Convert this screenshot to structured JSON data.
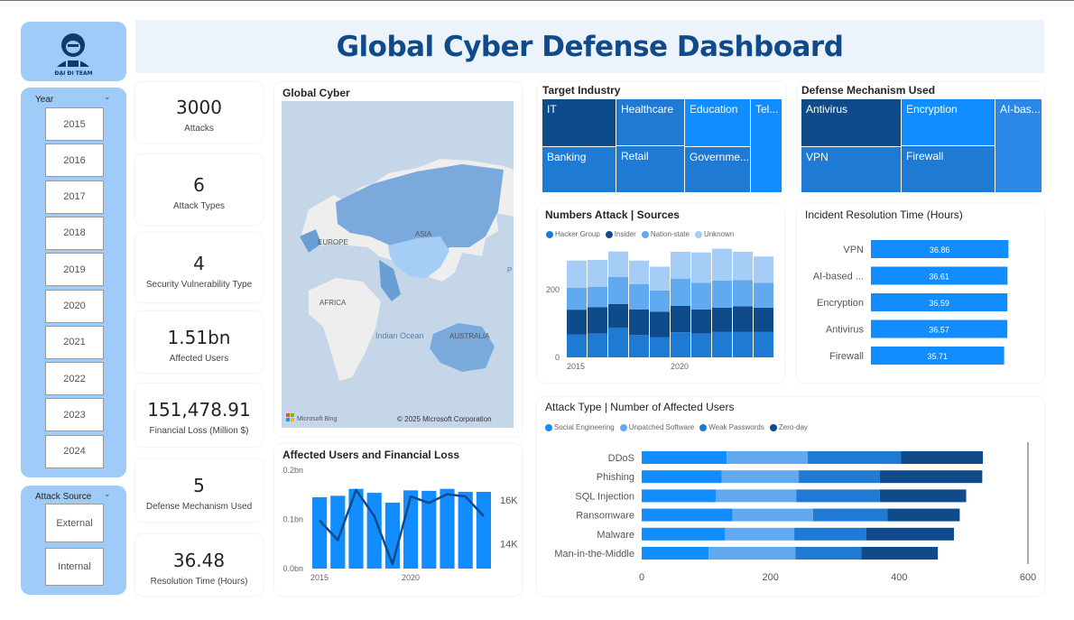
{
  "title": "Global Cyber Defense Dashboard",
  "logo": {
    "text": "ĐẠI ĐI TEAM"
  },
  "year_slicer": {
    "header": "Year",
    "items": [
      "2015",
      "2016",
      "2017",
      "2018",
      "2019",
      "2020",
      "2021",
      "2022",
      "2023",
      "2024"
    ]
  },
  "source_slicer": {
    "header": "Attack Source",
    "items": [
      "External",
      "Internal"
    ]
  },
  "kpis": [
    {
      "value": "3000",
      "label": "Attacks"
    },
    {
      "value": "6",
      "label": "Attack Types"
    },
    {
      "value": "4",
      "label": "Security Vulnerability Type"
    },
    {
      "value": "1.51bn",
      "label": "Affected Users"
    },
    {
      "value": "151,478.91",
      "label": "Financial Loss (Million $)"
    },
    {
      "value": "5",
      "label": "Defense Mechanism Used"
    },
    {
      "value": "36.48",
      "label": "Resolution Time (Hours)"
    }
  ],
  "map": {
    "title": "Global Cyber",
    "labels": [
      "EUROPE",
      "ASIA",
      "AFRICA",
      "Indian Ocean",
      "AUSTRALIA",
      "P"
    ],
    "provider": "Microsoft Bing",
    "copyright": "© 2025 Microsoft Corporation",
    "colors": {
      "water": "#c4d6e8",
      "land": "#eeeeee",
      "highlight": "#6a9fd6"
    }
  },
  "colors": {
    "dark": "#0f4a8b",
    "mid": "#1f7ad4",
    "blue": "#118dff",
    "light": "#62aaf0",
    "pale": "#a6cdf5",
    "accent": "#9ecbf7"
  },
  "charts": {
    "target_industry": {
      "title": "Target Industry"
    },
    "defense": {
      "title": "Defense Mechanism Used"
    },
    "sources": {
      "title": "Numbers Attack | Sources",
      "yticks": [
        "0",
        "200"
      ],
      "xticks": [
        "2015",
        "2020"
      ]
    },
    "resolution": {
      "title": "Incident Resolution Time (Hours)"
    },
    "users_loss": {
      "title": "Affected Users and Financial Loss",
      "yleft": [
        "0.0bn",
        "0.1bn",
        "0.2bn"
      ],
      "yright": [
        "14K",
        "16K"
      ],
      "xticks": [
        "2015",
        "2020"
      ]
    },
    "attack_type": {
      "title": "Attack Type | Number of Affected Users",
      "xticks": [
        "0",
        "200",
        "400",
        "600"
      ]
    }
  },
  "chart_data": [
    {
      "type": "treemap",
      "title": "Target Industry",
      "categories": [
        "IT",
        "Banking",
        "Healthcare",
        "Retail",
        "Education",
        "Government",
        "Telecommunications"
      ],
      "labels": [
        "IT",
        "Banking",
        "Healthcare",
        "Retail",
        "Education",
        "Governme...",
        "Tel..."
      ]
    },
    {
      "type": "treemap",
      "title": "Defense Mechanism Used",
      "categories": [
        "Antivirus",
        "VPN",
        "Encryption",
        "Firewall",
        "AI-based Detection"
      ],
      "labels": [
        "Antivirus",
        "VPN",
        "Encryption",
        "Firewall",
        "AI-bas..."
      ]
    },
    {
      "type": "bar",
      "stacked": true,
      "title": "Numbers Attack | Sources",
      "x": [
        2015,
        2016,
        2017,
        2018,
        2019,
        2020,
        2021,
        2022,
        2023,
        2024
      ],
      "series": [
        {
          "name": "Hacker Group",
          "values": [
            68,
            70,
            88,
            66,
            60,
            74,
            70,
            75,
            75,
            75
          ],
          "color": "#1f7ad4"
        },
        {
          "name": "Insider",
          "values": [
            73,
            78,
            70,
            76,
            75,
            78,
            72,
            72,
            76,
            72
          ],
          "color": "#0f4a8b"
        },
        {
          "name": "Nation-state",
          "values": [
            65,
            60,
            80,
            74,
            63,
            80,
            78,
            80,
            77,
            73
          ],
          "color": "#62aaf0"
        },
        {
          "name": "Unknown",
          "values": [
            80,
            80,
            75,
            70,
            70,
            80,
            90,
            94,
            84,
            78
          ],
          "color": "#a6cdf5"
        }
      ],
      "ylim": [
        0,
        320
      ],
      "xticks": [
        "2015",
        "2020"
      ]
    },
    {
      "type": "bar",
      "orientation": "horizontal",
      "title": "Incident Resolution Time (Hours)",
      "categories": [
        "VPN",
        "AI-based ...",
        "Encryption",
        "Antivirus",
        "Firewall"
      ],
      "values": [
        36.86,
        36.61,
        36.59,
        36.57,
        35.71
      ],
      "xlim": [
        0,
        37.5
      ],
      "color": "#118dff"
    },
    {
      "type": "bar",
      "title": "Affected Users and Financial Loss",
      "x": [
        2015,
        2016,
        2017,
        2018,
        2019,
        2020,
        2021,
        2022,
        2023,
        2024
      ],
      "series": [
        {
          "name": "Affected Users",
          "values": [
            0.145,
            0.148,
            0.162,
            0.154,
            0.134,
            0.159,
            0.158,
            0.162,
            0.156,
            0.156
          ],
          "color": "#118dff",
          "axis": "left",
          "unit": "bn"
        },
        {
          "name": "Financial Loss",
          "type": "line",
          "values": [
            15100,
            14200,
            16500,
            15300,
            13100,
            16200,
            15900,
            16300,
            16200,
            15300
          ],
          "color": "#0f4a8b",
          "axis": "right"
        }
      ],
      "ylim_left": [
        0,
        0.2
      ],
      "ylim_right": [
        12900,
        17400
      ],
      "xticks": [
        "2015",
        "2020"
      ]
    },
    {
      "type": "bar",
      "orientation": "horizontal",
      "stacked": true,
      "title": "Attack Type | Number of Affected Users",
      "categories": [
        "DDoS",
        "Phishing",
        "SQL Injection",
        "Ransomware",
        "Malware",
        "Man-in-the-Middle"
      ],
      "series": [
        {
          "name": "Social Engineering",
          "values": [
            132,
            124,
            115,
            141,
            129,
            104
          ],
          "color": "#118dff"
        },
        {
          "name": "Unpatched Software",
          "values": [
            126,
            120,
            125,
            125,
            108,
            135
          ],
          "color": "#62aaf0"
        },
        {
          "name": "Weak Passwords",
          "values": [
            145,
            126,
            130,
            116,
            112,
            102
          ],
          "color": "#1f7ad4"
        },
        {
          "name": "Zero-day",
          "values": [
            127,
            159,
            134,
            112,
            136,
            119
          ],
          "color": "#0f4a8b"
        }
      ],
      "xlim": [
        0,
        600
      ],
      "xticks": [
        "0",
        "200",
        "400",
        "600"
      ]
    }
  ]
}
